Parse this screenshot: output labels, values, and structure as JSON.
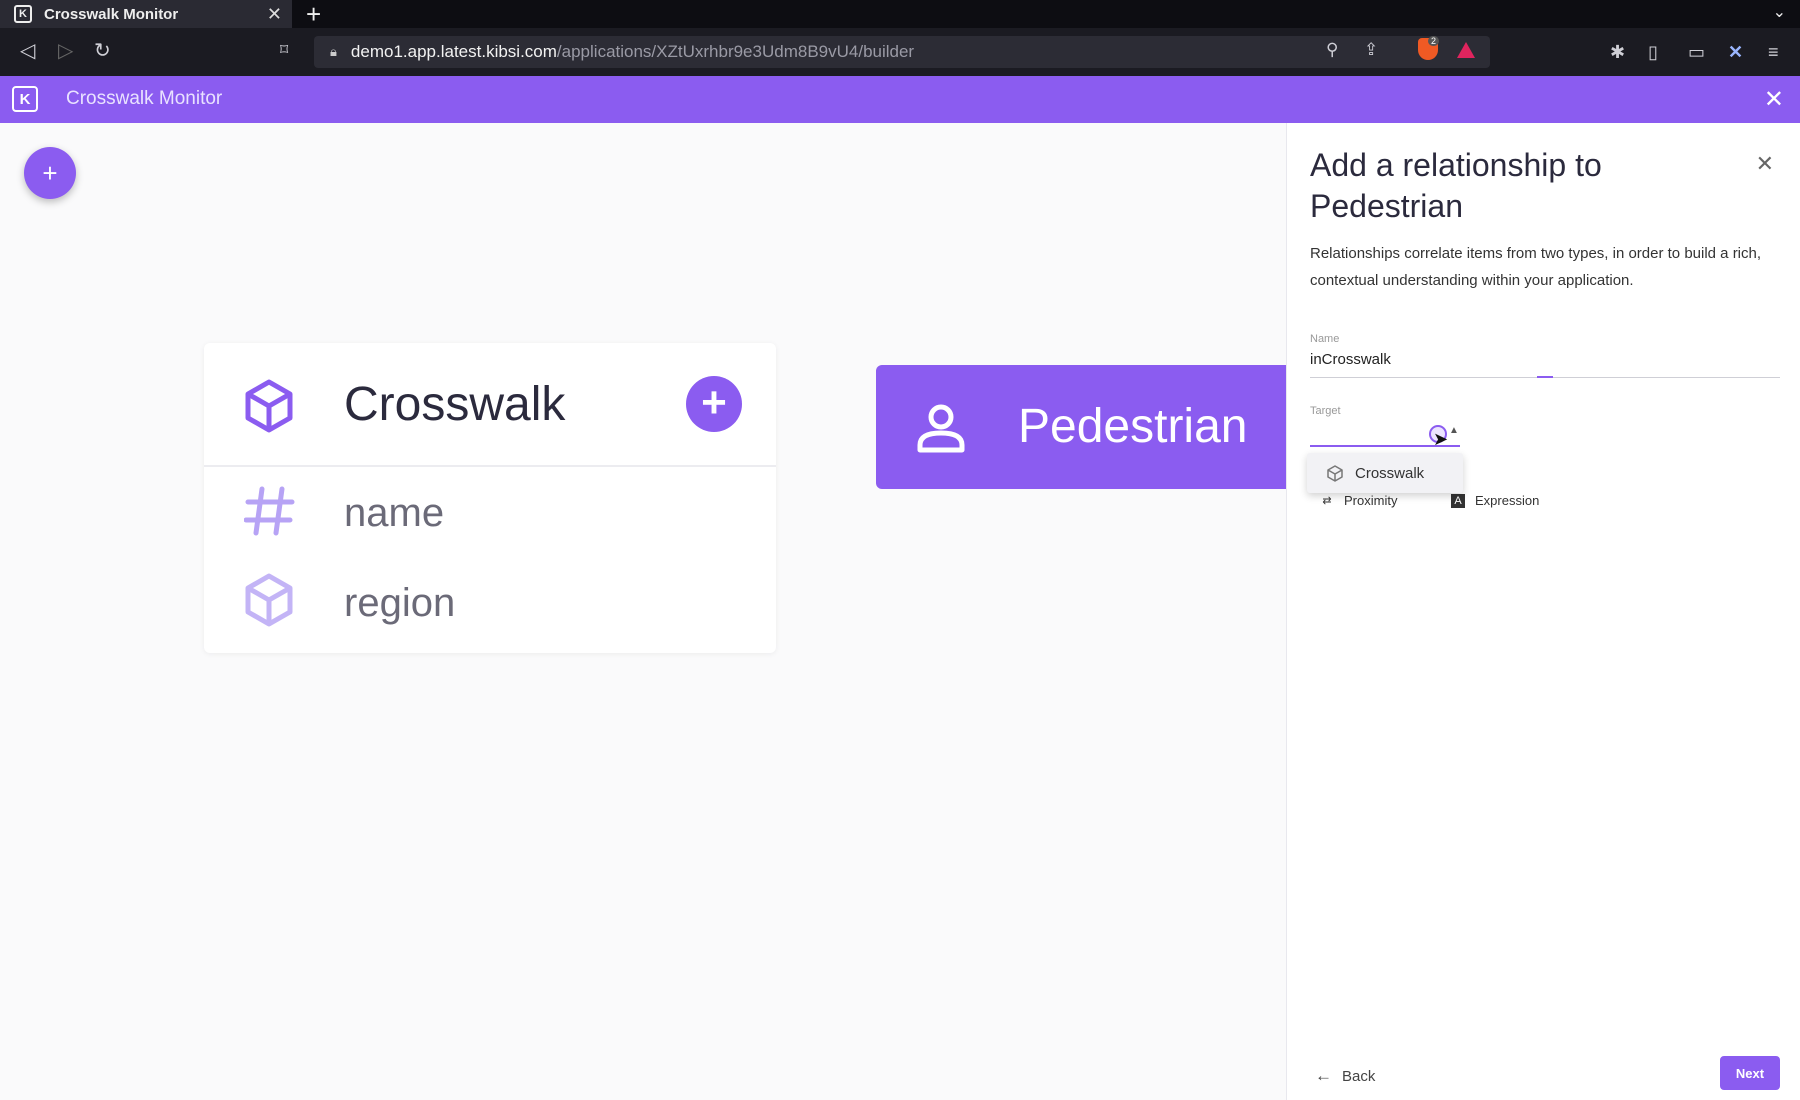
{
  "browser": {
    "tab_title": "Crosswalk Monitor",
    "url_host": "demo1.app.latest.kibsi.com",
    "url_path": "/applications/XZtUxrhbr9e3Udm8B9vU4/builder",
    "shields_count": "2"
  },
  "app": {
    "title": "Crosswalk Monitor",
    "accent_color": "#8b5cf0"
  },
  "canvas": {
    "crosswalk_card": {
      "title": "Crosswalk",
      "fields": [
        {
          "label": "name",
          "icon": "hash-icon"
        },
        {
          "label": "region",
          "icon": "cube-icon"
        }
      ]
    },
    "pedestrian_card": {
      "title": "Pedestrian",
      "icon": "person-icon"
    }
  },
  "panel": {
    "title": "Add a relationship to Pedestrian",
    "description": "Relationships correlate items from two types, in order to build a rich, contextual understanding within your application.",
    "name_label": "Name",
    "name_value": "inCrosswalk",
    "target_label": "Target",
    "dropdown_option": "Crosswalk",
    "types": [
      "Proximity",
      "Expression"
    ],
    "back_label": "Back",
    "next_label": "Next"
  }
}
